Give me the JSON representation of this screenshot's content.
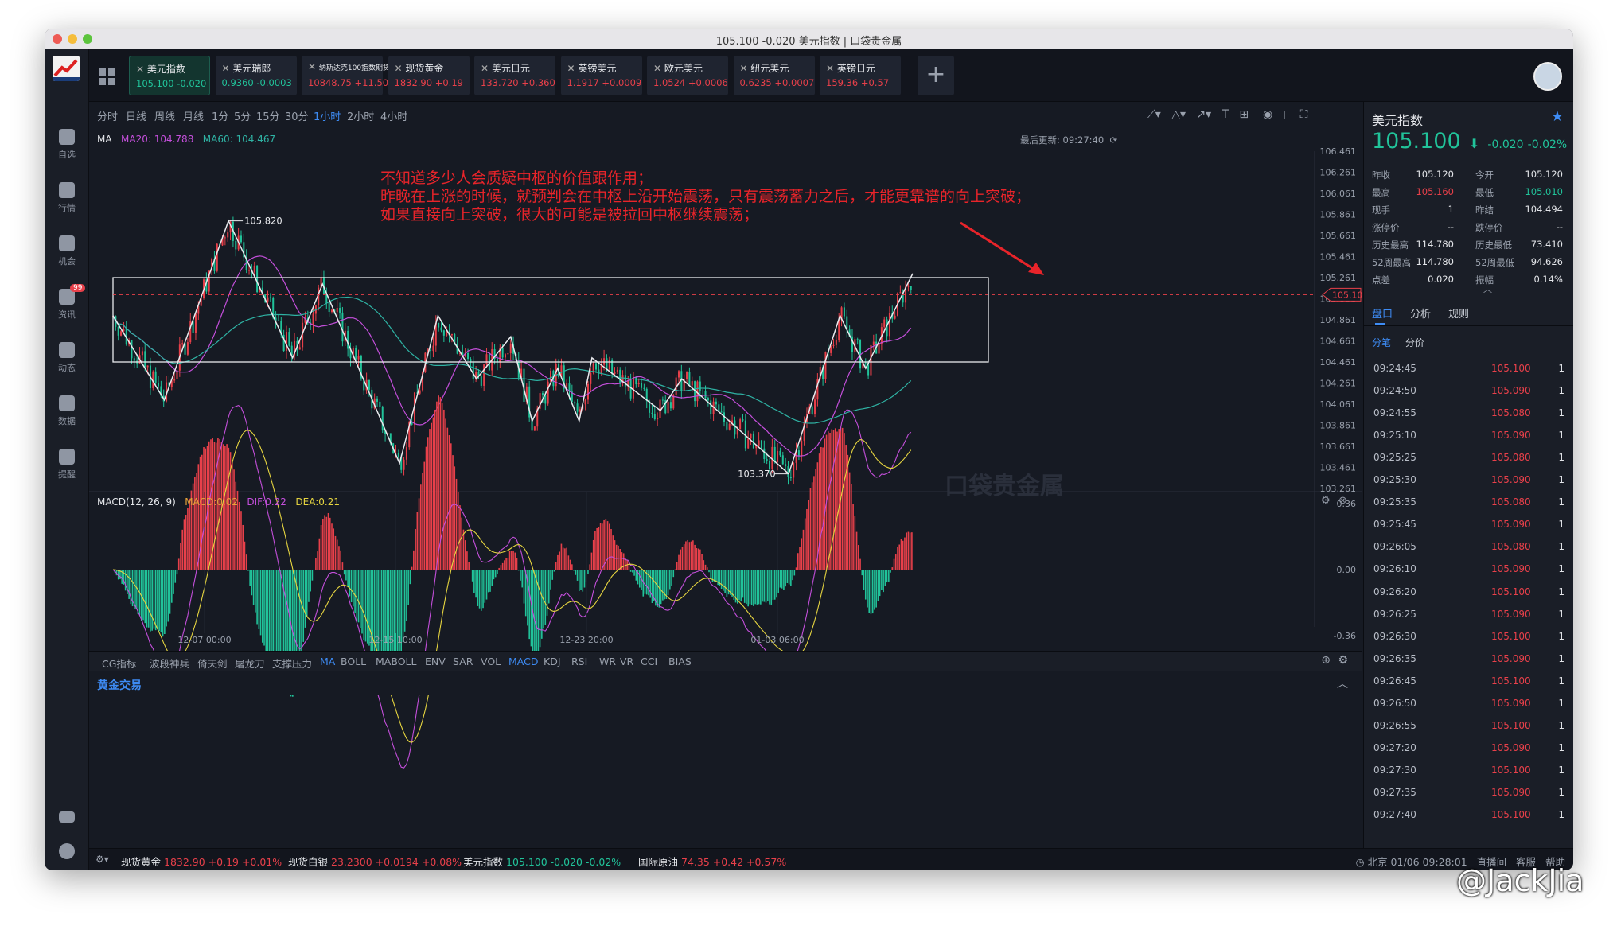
{
  "window": {
    "title": "105.100 -0.020 美元指数 | 口袋贵金属"
  },
  "sidebar": {
    "items": [
      {
        "label": "自选"
      },
      {
        "label": "行情"
      },
      {
        "label": "机会"
      },
      {
        "label": "资讯",
        "badge": "99"
      },
      {
        "label": "动态"
      },
      {
        "label": "数据"
      },
      {
        "label": "提醒"
      }
    ]
  },
  "tabs": [
    {
      "name": "美元指数",
      "price": "105.100",
      "change": "-0.020",
      "dir": "down",
      "active": true
    },
    {
      "name": "美元瑞郎",
      "price": "0.9360",
      "change": "-0.0003",
      "dir": "down"
    },
    {
      "name": "纳斯达克100指数期货",
      "price": "10848.75",
      "change": "+11.50",
      "dir": "up"
    },
    {
      "name": "现货黄金",
      "price": "1832.90",
      "change": "+0.19",
      "dir": "up"
    },
    {
      "name": "美元日元",
      "price": "133.720",
      "change": "+0.360",
      "dir": "up"
    },
    {
      "name": "英镑美元",
      "price": "1.1917",
      "change": "+0.0009",
      "dir": "up"
    },
    {
      "name": "欧元美元",
      "price": "1.0524",
      "change": "+0.0006",
      "dir": "up"
    },
    {
      "name": "纽元美元",
      "price": "0.6235",
      "change": "+0.0007",
      "dir": "up"
    },
    {
      "name": "英镑日元",
      "price": "159.36",
      "change": "+0.57",
      "dir": "up"
    }
  ],
  "timeframes": [
    "分时",
    "日线",
    "周线",
    "月线",
    "1分",
    "5分",
    "15分",
    "30分",
    "1小时",
    "2小时",
    "4小时"
  ],
  "active_timeframe": "1小时",
  "ma": {
    "label": "MA",
    "ma20": "MA20: 104.788",
    "ma60": "MA60: 104.467"
  },
  "last_update": "最后更新: 09:27:40",
  "annotation": {
    "line1": "不知道多少人会质疑中枢的价值跟作用；",
    "line2": "昨晚在上涨的时候，就预判会在中枢上沿开始震荡，只有震荡蓄力之后，才能更靠谱的向上突破；",
    "line3": "如果直接向上突破，很大的可能是被拉回中枢继续震荡；"
  },
  "macd": {
    "label": "MACD(12, 26, 9)",
    "macd": "MACD:0.02",
    "dif": "DIF:0.22",
    "dea": "DEA:0.21",
    "ticks": [
      "0.36",
      "0.00",
      "-0.36"
    ]
  },
  "watermark": "口袋贵金属",
  "indicators": [
    "CG指标",
    "波段神兵",
    "倚天剑",
    "屠龙刀",
    "支撑压力",
    "MA",
    "BOLL",
    "MABOLL",
    "ENV",
    "SAR",
    "VOL",
    "MACD",
    "KDJ",
    "RSI",
    "WR",
    "VR",
    "CCI",
    "BIAS"
  ],
  "active_indicators": [
    "MA",
    "MACD"
  ],
  "gold_trade": "黄金交易",
  "chart_data": {
    "type": "candlestick",
    "y_ticks": [
      "106.461",
      "106.261",
      "106.061",
      "105.861",
      "105.661",
      "105.461",
      "105.261",
      "105.061",
      "104.861",
      "104.661",
      "104.461",
      "104.261",
      "104.061",
      "103.861",
      "103.661",
      "103.461",
      "103.261"
    ],
    "ylim": [
      103.261,
      106.461
    ],
    "x_ticks": [
      "12-07 00:00",
      "12-15 10:00",
      "12-23 20:00",
      "01-03 06:00"
    ],
    "current_price": "105.100",
    "high_label": "105.820",
    "low_label": "103.370",
    "box": {
      "upper": 105.261,
      "lower": 104.461
    },
    "zigzag": [
      104.9,
      104.1,
      105.8,
      104.5,
      105.2,
      103.5,
      104.9,
      104.3,
      104.7,
      103.9,
      104.4,
      103.9,
      104.5,
      104.0,
      104.3,
      103.4,
      104.9,
      104.4,
      105.3
    ]
  },
  "right": {
    "title": "美元指数",
    "price": "105.100",
    "change": "-0.020",
    "pct": "-0.02%",
    "stats": [
      [
        "昨收",
        "105.120",
        "今开",
        "105.120"
      ],
      [
        "最高",
        "105.160",
        "最低",
        "105.010"
      ],
      [
        "现手",
        "1",
        "昨结",
        "104.494"
      ],
      [
        "涨停价",
        "--",
        "跌停价",
        "--"
      ],
      [
        "历史最高",
        "114.780",
        "历史最低",
        "73.410"
      ],
      [
        "52周最高",
        "114.780",
        "52周最低",
        "94.626"
      ],
      [
        "点差",
        "0.020",
        "振幅",
        "0.14%"
      ]
    ],
    "tabs": [
      "盘口",
      "分析",
      "规则"
    ],
    "subtabs": [
      "分笔",
      "分价"
    ],
    "trades": [
      [
        "09:24:45",
        "105.100",
        "1"
      ],
      [
        "09:24:50",
        "105.090",
        "1"
      ],
      [
        "09:24:55",
        "105.080",
        "1"
      ],
      [
        "09:25:10",
        "105.090",
        "1"
      ],
      [
        "09:25:25",
        "105.080",
        "1"
      ],
      [
        "09:25:30",
        "105.090",
        "1"
      ],
      [
        "09:25:35",
        "105.080",
        "1"
      ],
      [
        "09:25:45",
        "105.090",
        "1"
      ],
      [
        "09:26:05",
        "105.080",
        "1"
      ],
      [
        "09:26:10",
        "105.090",
        "1"
      ],
      [
        "09:26:20",
        "105.100",
        "1"
      ],
      [
        "09:26:25",
        "105.090",
        "1"
      ],
      [
        "09:26:30",
        "105.100",
        "1"
      ],
      [
        "09:26:35",
        "105.090",
        "1"
      ],
      [
        "09:26:45",
        "105.100",
        "1"
      ],
      [
        "09:26:50",
        "105.090",
        "1"
      ],
      [
        "09:26:55",
        "105.100",
        "1"
      ],
      [
        "09:27:20",
        "105.090",
        "1"
      ],
      [
        "09:27:30",
        "105.100",
        "1"
      ],
      [
        "09:27:35",
        "105.090",
        "1"
      ],
      [
        "09:27:40",
        "105.100",
        "1"
      ]
    ]
  },
  "status": {
    "items": [
      {
        "name": "现货黄金",
        "val": "1832.90 +0.19 +0.01%"
      },
      {
        "name": "现货白银",
        "val": "23.2300 +0.0194 +0.08%"
      },
      {
        "name": "美元指数",
        "val": "105.100 -0.020 -0.02%"
      },
      {
        "name": "国际原油",
        "val": "74.35 +0.42 +0.57%"
      }
    ],
    "clock": "北京 01/06 09:28:01",
    "live": "直播间",
    "service": "客服",
    "help": "帮助"
  },
  "credit": "@JackJia"
}
